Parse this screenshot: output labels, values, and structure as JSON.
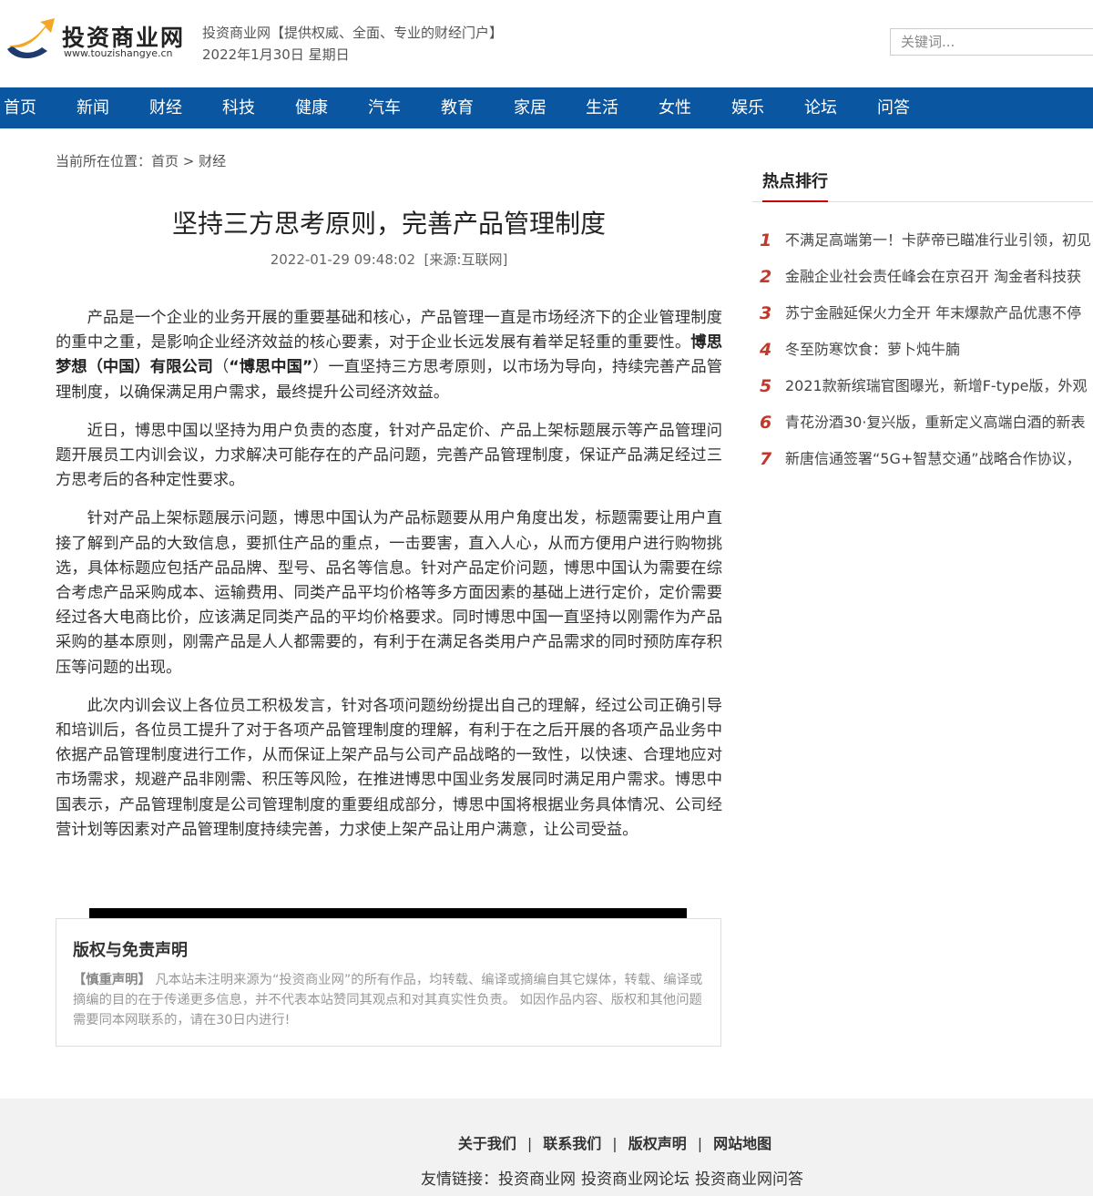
{
  "header": {
    "logo_cn": "投资商业网",
    "logo_en": "www.touzishangye.cn",
    "tagline": "投资商业网【提供权威、全面、专业的财经门户】",
    "date": "2022年1月30日 星期日",
    "search_placeholder": "关键词...",
    "logo_colors": {
      "swoosh": "#f5a623",
      "dark": "#1f3a6e"
    }
  },
  "nav": {
    "items": [
      "首页",
      "新闻",
      "财经",
      "科技",
      "健康",
      "汽车",
      "教育",
      "家居",
      "生活",
      "女性",
      "娱乐",
      "论坛",
      "问答"
    ],
    "bg_color": "#0a56a0"
  },
  "breadcrumb": {
    "prefix": "当前所在位置：",
    "home": "首页",
    "sep": " > ",
    "current": "财经"
  },
  "article": {
    "title": "坚持三方思考原则，完善产品管理制度",
    "meta": "2022-01-29 09:48:02  [来源:互联网]",
    "p1_a": "产品是一个企业的业务开展的重要基础和核心，产品管理一直是市场经济下的企业管理制度的重中之重，是影响企业经济效益的核心要素，对于企业长远发展有着举足轻重的重要性。",
    "p1_b": "博思梦想（中国）有限公司",
    "p1_c": "（",
    "p1_d": "“博思中国”",
    "p1_e": "）一直坚持三方思考原则，以市场为导向，持续完善产品管理制度，以确保满足用户需求，最终提升公司经济效益。",
    "p2": "近日，博思中国以坚持为用户负责的态度，针对产品定价、产品上架标题展示等产品管理问题开展员工内训会议，力求解决可能存在的产品问题，完善产品管理制度，保证产品满足经过三方思考后的各种定性要求。",
    "p3": "针对产品上架标题展示问题，博思中国认为产品标题要从用户角度出发，标题需要让用户直接了解到产品的大致信息，要抓住产品的重点，一击要害，直入人心，从而方便用户进行购物挑选，具体标题应包括产品品牌、型号、品名等信息。针对产品定价问题，博思中国认为需要在综合考虑产品采购成本、运输费用、同类产品平均价格等多方面因素的基础上进行定价，定价需要经过各大电商比价，应该满足同类产品的平均价格要求。同时博思中国一直坚持以刚需作为产品采购的基本原则，刚需产品是人人都需要的，有利于在满足各类用户产品需求的同时预防库存积压等问题的出现。",
    "p4": "此次内训会议上各位员工积极发言，针对各项问题纷纷提出自己的理解，经过公司正确引导和培训后，各位员工提升了对于各项产品管理制度的理解，有利于在之后开展的各项产品业务中依据产品管理制度进行工作，从而保证上架产品与公司产品战略的一致性，以快速、合理地应对市场需求，规避产品非刚需、积压等风险，在推进博思中国业务发展同时满足用户需求。博思中国表示，产品管理制度是公司管理制度的重要组成部分，博思中国将根据业务具体情况、公司经营计划等因素对产品管理制度持续完善，力求使上架产品让用户满意，让公司受益。"
  },
  "disclaimer": {
    "title": "版权与免责声明",
    "label": "【慎重声明】",
    "text": "凡本站未注明来源为“投资商业网”的所有作品，均转载、编译或摘编自其它媒体，转载、编译或摘编的目的在于传递更多信息，并不代表本站赞同其观点和对其真实性负责。 如因作品内容、版权和其他问题需要同本网联系的，请在30日内进行!"
  },
  "sidebar": {
    "title": "热点排行",
    "items": [
      {
        "num": "1",
        "text": "不满足高端第一！卡萨帝已瞄准行业引领，初见"
      },
      {
        "num": "2",
        "text": "金融企业社会责任峰会在京召开 淘金者科技获"
      },
      {
        "num": "3",
        "text": "苏宁金融延保火力全开 年末爆款产品优惠不停"
      },
      {
        "num": "4",
        "text": "冬至防寒饮食：萝卜炖牛腩"
      },
      {
        "num": "5",
        "text": "2021款新缤瑞官图曝光，新增F-type版，外观"
      },
      {
        "num": "6",
        "text": "青花汾酒30·复兴版，重新定义高端白酒的新表"
      },
      {
        "num": "7",
        "text": "新唐信通签署“5G+智慧交通”战略合作协议，"
      }
    ]
  },
  "footer": {
    "links": [
      "关于我们",
      "联系我们",
      "版权声明",
      "网站地图"
    ],
    "separator": "|",
    "friends_label": "友情链接：",
    "friends": [
      "投资商业网",
      "投资商业网论坛",
      "投资商业网问答"
    ]
  }
}
